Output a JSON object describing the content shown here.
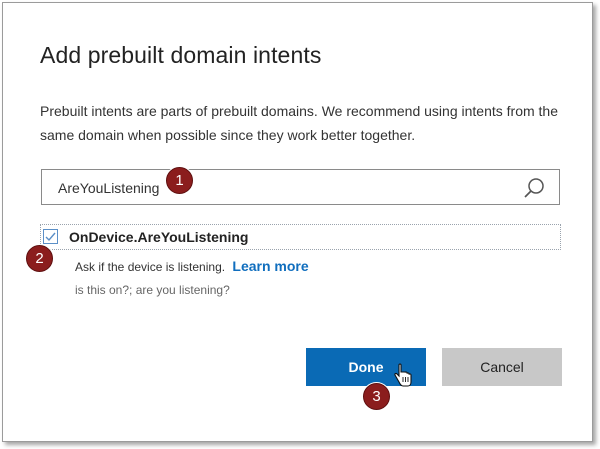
{
  "dialog": {
    "title": "Add prebuilt domain intents",
    "description": "Prebuilt intents are parts of prebuilt domains. We recommend using intents from the same domain when possible since they work better together."
  },
  "search": {
    "value": "AreYouListening"
  },
  "result": {
    "name": "OnDevice.AreYouListening",
    "checked": true,
    "description": "Ask if the device is listening.",
    "learn_more": "Learn more",
    "examples": "is this on?; are you listening?"
  },
  "buttons": {
    "done": "Done",
    "cancel": "Cancel"
  },
  "callouts": {
    "one": "1",
    "two": "2",
    "three": "3"
  },
  "colors": {
    "primary_button": "#0a6ab5",
    "secondary_button": "#c8c8c8",
    "link": "#106ebe",
    "callout": "#8b1d1d"
  },
  "icons": {
    "search": "search-icon",
    "checkbox": "checkmark-icon",
    "cursor": "hand-pointer-icon"
  }
}
